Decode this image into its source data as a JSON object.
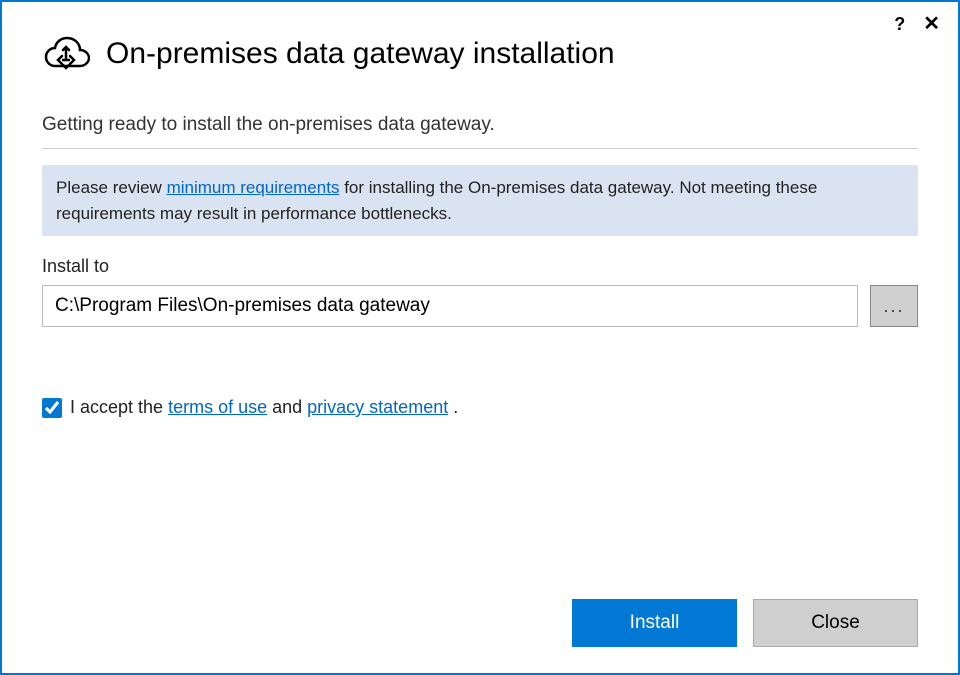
{
  "header": {
    "title": "On-premises data gateway installation"
  },
  "subtitle": "Getting ready to install the on-premises data gateway.",
  "infobox": {
    "pre": "Please review ",
    "link": "minimum requirements",
    "post": " for installing the On-premises data gateway. Not meeting these requirements may result in performance bottlenecks."
  },
  "install": {
    "label": "Install to",
    "path": "C:\\Program Files\\On-premises data gateway",
    "browse": "..."
  },
  "accept": {
    "pre": "I accept the ",
    "terms": "terms of use",
    "mid": " and ",
    "privacy": "privacy statement",
    "post": " ."
  },
  "buttons": {
    "install": "Install",
    "close": "Close"
  },
  "titlebar": {
    "help": "?",
    "close": "✕"
  }
}
